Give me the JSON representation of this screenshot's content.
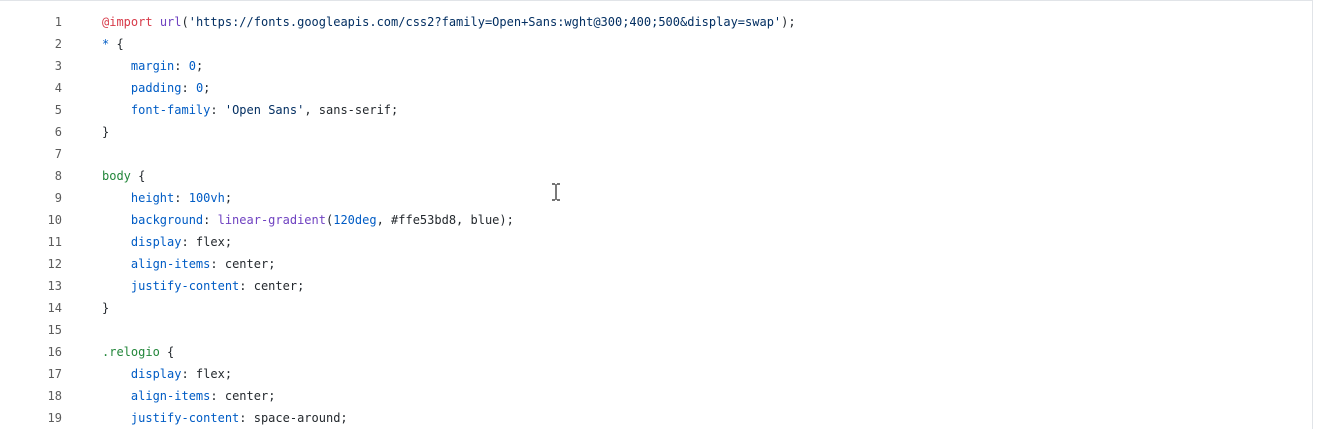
{
  "editor": {
    "lines": [
      {
        "n": "1",
        "tokens": [
          {
            "t": "atrule",
            "v": "@import"
          },
          {
            "t": "plain",
            "v": " "
          },
          {
            "t": "fn",
            "v": "url"
          },
          {
            "t": "plain",
            "v": "("
          },
          {
            "t": "str",
            "v": "'https://fonts.googleapis.com/css2?family=Open+Sans:wght@300;400;500&display=swap'"
          },
          {
            "t": "plain",
            "v": ");"
          }
        ]
      },
      {
        "n": "2",
        "tokens": [
          {
            "t": "prop",
            "v": "*"
          },
          {
            "t": "plain",
            "v": " {"
          }
        ]
      },
      {
        "n": "3",
        "tokens": [
          {
            "t": "plain",
            "v": "    "
          },
          {
            "t": "prop",
            "v": "margin"
          },
          {
            "t": "plain",
            "v": ": "
          },
          {
            "t": "num",
            "v": "0"
          },
          {
            "t": "plain",
            "v": ";"
          }
        ]
      },
      {
        "n": "4",
        "tokens": [
          {
            "t": "plain",
            "v": "    "
          },
          {
            "t": "prop",
            "v": "padding"
          },
          {
            "t": "plain",
            "v": ": "
          },
          {
            "t": "num",
            "v": "0"
          },
          {
            "t": "plain",
            "v": ";"
          }
        ]
      },
      {
        "n": "5",
        "tokens": [
          {
            "t": "plain",
            "v": "    "
          },
          {
            "t": "prop",
            "v": "font-family"
          },
          {
            "t": "plain",
            "v": ": "
          },
          {
            "t": "str",
            "v": "'Open Sans'"
          },
          {
            "t": "plain",
            "v": ", sans-serif;"
          }
        ]
      },
      {
        "n": "6",
        "tokens": [
          {
            "t": "plain",
            "v": "}"
          }
        ]
      },
      {
        "n": "7",
        "tokens": []
      },
      {
        "n": "8",
        "tokens": [
          {
            "t": "sel",
            "v": "body"
          },
          {
            "t": "plain",
            "v": " {"
          }
        ]
      },
      {
        "n": "9",
        "tokens": [
          {
            "t": "plain",
            "v": "    "
          },
          {
            "t": "prop",
            "v": "height"
          },
          {
            "t": "plain",
            "v": ": "
          },
          {
            "t": "num",
            "v": "100vh"
          },
          {
            "t": "plain",
            "v": ";"
          }
        ]
      },
      {
        "n": "10",
        "tokens": [
          {
            "t": "plain",
            "v": "    "
          },
          {
            "t": "prop",
            "v": "background"
          },
          {
            "t": "plain",
            "v": ": "
          },
          {
            "t": "fn",
            "v": "linear-gradient"
          },
          {
            "t": "plain",
            "v": "("
          },
          {
            "t": "num",
            "v": "120deg"
          },
          {
            "t": "plain",
            "v": ", #ffe53bd8, blue);"
          }
        ]
      },
      {
        "n": "11",
        "tokens": [
          {
            "t": "plain",
            "v": "    "
          },
          {
            "t": "prop",
            "v": "display"
          },
          {
            "t": "plain",
            "v": ": flex;"
          }
        ]
      },
      {
        "n": "12",
        "tokens": [
          {
            "t": "plain",
            "v": "    "
          },
          {
            "t": "prop",
            "v": "align-items"
          },
          {
            "t": "plain",
            "v": ": center;"
          }
        ]
      },
      {
        "n": "13",
        "tokens": [
          {
            "t": "plain",
            "v": "    "
          },
          {
            "t": "prop",
            "v": "justify-content"
          },
          {
            "t": "plain",
            "v": ": center;"
          }
        ]
      },
      {
        "n": "14",
        "tokens": [
          {
            "t": "plain",
            "v": "}"
          }
        ]
      },
      {
        "n": "15",
        "tokens": []
      },
      {
        "n": "16",
        "tokens": [
          {
            "t": "sel",
            "v": ".relogio"
          },
          {
            "t": "plain",
            "v": " {"
          }
        ]
      },
      {
        "n": "17",
        "tokens": [
          {
            "t": "plain",
            "v": "    "
          },
          {
            "t": "prop",
            "v": "display"
          },
          {
            "t": "plain",
            "v": ": flex;"
          }
        ]
      },
      {
        "n": "18",
        "tokens": [
          {
            "t": "plain",
            "v": "    "
          },
          {
            "t": "prop",
            "v": "align-items"
          },
          {
            "t": "plain",
            "v": ": center;"
          }
        ]
      },
      {
        "n": "19",
        "tokens": [
          {
            "t": "plain",
            "v": "    "
          },
          {
            "t": "prop",
            "v": "justify-content"
          },
          {
            "t": "plain",
            "v": ": space-around;"
          }
        ]
      }
    ]
  },
  "cursor": {
    "icon": "text-cursor-icon"
  }
}
